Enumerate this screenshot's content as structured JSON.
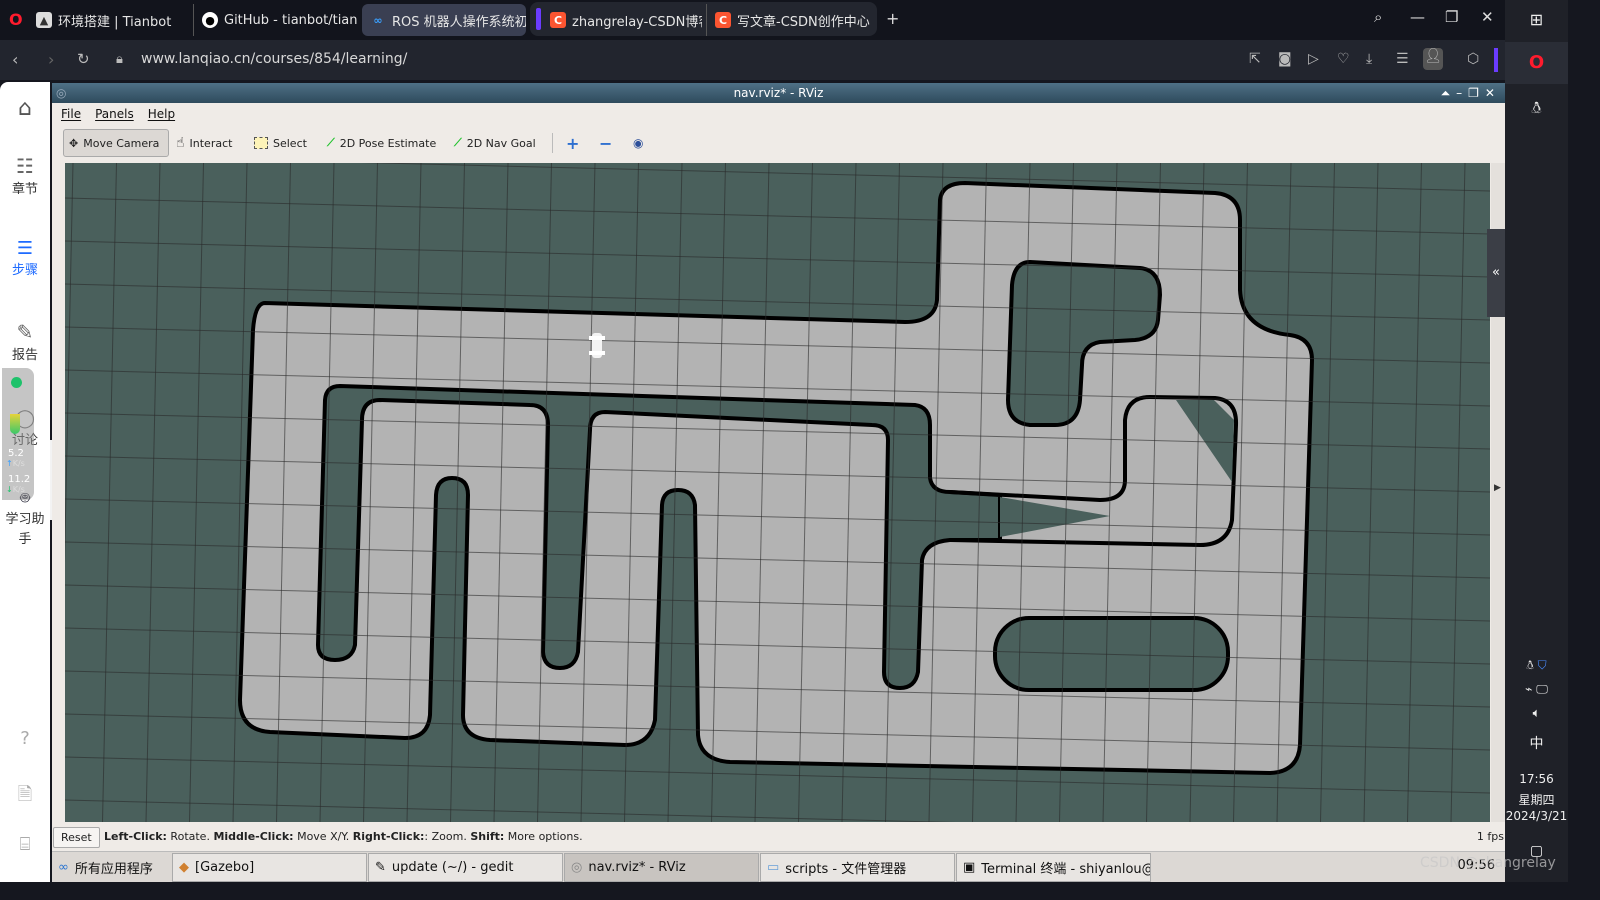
{
  "browser": {
    "tabs": [
      {
        "label": "环境搭建 | Tianbot",
        "icon": "tianbot-favicon"
      },
      {
        "label": "GitHub - tianbot/tianrac",
        "icon": "github-icon"
      },
      {
        "label": "ROS 机器人操作系统初级",
        "icon": "lanqiao-favicon",
        "active": true
      },
      {
        "label": "zhangrelay-CSDN博客",
        "icon": "csdn-favicon"
      },
      {
        "label": "写文章-CSDN创作中心",
        "icon": "csdn-favicon"
      }
    ],
    "csdn_letter": "C",
    "url": "www.lanqiao.cn/courses/854/learning/",
    "colors": {
      "accent": "#6b3cff",
      "csdn": "#fc5531",
      "opera": "#ff1b2d"
    }
  },
  "lanqiao_sidebar": {
    "items": [
      {
        "label": "",
        "icon": "home-icon"
      },
      {
        "label": "章节",
        "icon": "chapters-icon"
      },
      {
        "label": "步骤",
        "icon": "steps-icon",
        "active": true
      },
      {
        "label": "报告",
        "icon": "pencil-icon"
      },
      {
        "label": "讨论",
        "icon": "chat-icon"
      },
      {
        "label": "学习助手",
        "icon": "robot-icon"
      }
    ],
    "net_up": "5.2",
    "net_down": "11.2",
    "net_unit": "K/s",
    "help_icon": "?"
  },
  "rviz": {
    "title": "nav.rviz* - RViz",
    "menu": [
      "File",
      "Panels",
      "Help"
    ],
    "tools": [
      {
        "label": "Move Camera",
        "icon": "move-camera-icon",
        "active": true
      },
      {
        "label": "Interact",
        "icon": "hand-icon"
      },
      {
        "label": "Select",
        "icon": "select-icon"
      },
      {
        "label": "2D Pose Estimate",
        "icon": "green-arrow-icon"
      },
      {
        "label": "2D Nav Goal",
        "icon": "green-arrow-icon"
      }
    ],
    "status": {
      "reset": "Reset",
      "parts": [
        [
          "Left-Click:",
          " Rotate. "
        ],
        [
          "Middle-Click:",
          " Move X/Y. "
        ],
        [
          "Right-Click:",
          ": Zoom. "
        ],
        [
          "Shift:",
          " More options."
        ]
      ],
      "fps": "1 fps"
    },
    "map_colors": {
      "unknown": "#4a605c",
      "free": "#b3b3b3",
      "wall": "#000000"
    }
  },
  "taskbar": {
    "items": [
      "所有应用程序",
      "[Gazebo]",
      "update (~/) - gedit",
      "nav.rviz* - RViz",
      "scripts - 文件管理器",
      "Terminal 终端 - shiyanlou@⋯"
    ],
    "clock": "09:56"
  },
  "system_tray": {
    "ime": "中",
    "time": "17:56",
    "weekday": "星期四",
    "date": "2024/3/21"
  },
  "watermark": "CSDN @zhangrelay"
}
